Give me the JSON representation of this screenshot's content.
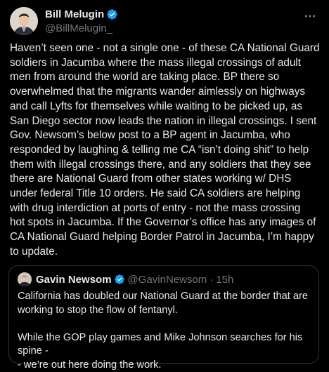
{
  "author": {
    "display_name": "Bill Melugin",
    "handle": "@BillMelugin_",
    "verified_icon": "verified-badge-icon",
    "avatar_icon": "profile-photo"
  },
  "more_icon": "more-options-icon",
  "tweet_text": "Haven’t seen one - not a single one - of these CA National Guard\nsoldiers in Jacumba where the mass illegal crossings  of adult\nmen from around the world are taking place. BP there so\noverwhelmed that the migrants wander aimlessly on highways\nand call Lyfts for themselves while waiting to be picked up, as\nSan Diego sector now leads the nation in illegal crossings. I sent\nGov. Newsom’s below post to a BP agent in Jacumba, who\nresponded by laughing & telling me CA “isn’t doing shit” to help\nthem with illegal crossings there, and any soldiers that they see\nthere are National Guard from other states working w/ DHS\nunder federal Title 10 orders. He said CA soldiers are helping\nwith drug interdiction at ports of entry - not the mass crossing\nhot spots in Jacumba. If the Governor’s office has any images of\nCA National Guard helping Border Patrol in Jacumba, I’m happy\nto update.",
  "quoted_tweet": {
    "display_name": "Gavin Newsom",
    "handle": "@GavinNewsom",
    "separator": "·",
    "time": "15h",
    "text": "California has doubled our National Guard at the border that are\nworking to stop the flow of fentanyl.\n\nWhile the GOP play games and Mike Johnson searches for his spine -\n- we’re out here doing the work."
  },
  "colors": {
    "background": "#000000",
    "text": "#e7e9ea",
    "secondary_text": "#71767b",
    "verified_blue": "#1d9bf0",
    "border": "#2f3336"
  }
}
